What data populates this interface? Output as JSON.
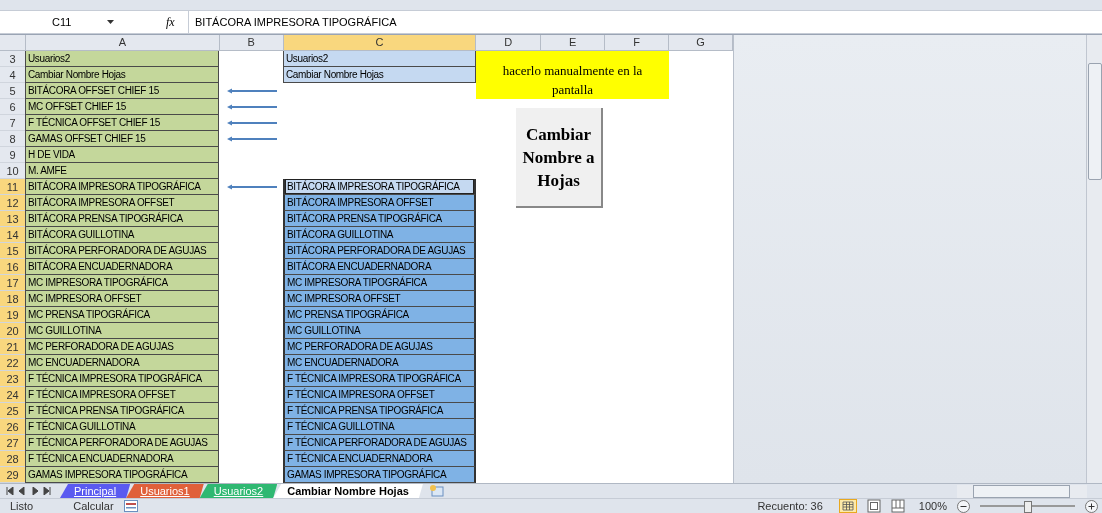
{
  "formula_bar": {
    "name_box": "C11",
    "fx": "fx",
    "formula": "BITÁCORA IMPRESORA TIPOGRÁFICA"
  },
  "columns": [
    {
      "label": "A",
      "selected": false
    },
    {
      "label": "B",
      "selected": false
    },
    {
      "label": "C",
      "selected": true
    },
    {
      "label": "D",
      "selected": false
    },
    {
      "label": "E",
      "selected": false
    },
    {
      "label": "F",
      "selected": false
    },
    {
      "label": "G",
      "selected": false
    }
  ],
  "rows": [
    {
      "num": "3",
      "a": "Usuarios2",
      "arrow": false,
      "c": "Usuarios2",
      "selected": false,
      "active": false
    },
    {
      "num": "4",
      "a": "Cambiar Nombre Hojas",
      "arrow": false,
      "c": "Cambiar Nombre Hojas",
      "selected": false,
      "active": false
    },
    {
      "num": "5",
      "a": "BITÁCORA OFFSET CHIEF 15",
      "arrow": true,
      "selected": false
    },
    {
      "num": "6",
      "a": "MC OFFSET CHIEF 15",
      "arrow": true,
      "selected": false
    },
    {
      "num": "7",
      "a": "F TÉCNICA OFFSET CHIEF 15",
      "arrow": true,
      "selected": false
    },
    {
      "num": "8",
      "a": "GAMAS OFFSET CHIEF 15",
      "arrow": true,
      "selected": false
    },
    {
      "num": "9",
      "a": "H DE VIDA",
      "arrow": false,
      "selected": false
    },
    {
      "num": "10",
      "a": "M. AMFE",
      "arrow": false,
      "selected": false
    },
    {
      "num": "11",
      "a": "BITÁCORA IMPRESORA TIPOGRÁFICA",
      "arrow": true,
      "c": "BITÁCORA IMPRESORA TIPOGRÁFICA",
      "selected": true,
      "active": true
    },
    {
      "num": "12",
      "a": "BITÁCORA IMPRESORA OFFSET",
      "arrow": false,
      "c": "BITÁCORA IMPRESORA OFFSET",
      "selected": true,
      "active": false
    },
    {
      "num": "13",
      "a": "BITÁCORA PRENSA TIPOGRÁFICA",
      "arrow": false,
      "c": "BITÁCORA PRENSA TIPOGRÁFICA",
      "selected": true,
      "active": false
    },
    {
      "num": "14",
      "a": "BITÁCORA GUILLOTINA",
      "arrow": false,
      "c": "BITÁCORA GUILLOTINA",
      "selected": true,
      "active": false
    },
    {
      "num": "15",
      "a": "BITÁCORA PERFORADORA DE AGUJAS",
      "arrow": false,
      "c": "BITÁCORA PERFORADORA DE AGUJAS",
      "selected": true,
      "active": false
    },
    {
      "num": "16",
      "a": "BITÁCORA ENCUADERNADORA",
      "arrow": false,
      "c": "BITÁCORA ENCUADERNADORA",
      "selected": true,
      "active": false
    },
    {
      "num": "17",
      "a": "MC IMPRESORA TIPOGRÁFICA",
      "arrow": false,
      "c": "MC IMPRESORA TIPOGRÁFICA",
      "selected": true,
      "active": false
    },
    {
      "num": "18",
      "a": "MC IMPRESORA OFFSET",
      "arrow": false,
      "c": "MC IMPRESORA OFFSET",
      "selected": true,
      "active": false
    },
    {
      "num": "19",
      "a": "MC PRENSA TIPOGRÁFICA",
      "arrow": false,
      "c": "MC PRENSA TIPOGRÁFICA",
      "selected": true,
      "active": false
    },
    {
      "num": "20",
      "a": "MC GUILLOTINA",
      "arrow": false,
      "c": "MC GUILLOTINA",
      "selected": true,
      "active": false
    },
    {
      "num": "21",
      "a": "MC PERFORADORA DE AGUJAS",
      "arrow": false,
      "c": "MC PERFORADORA DE AGUJAS",
      "selected": true,
      "active": false
    },
    {
      "num": "22",
      "a": "MC ENCUADERNADORA",
      "arrow": false,
      "c": "MC ENCUADERNADORA",
      "selected": true,
      "active": false
    },
    {
      "num": "23",
      "a": "F TÉCNICA IMPRESORA TIPOGRÁFICA",
      "arrow": false,
      "c": "F TÉCNICA IMPRESORA TIPOGRÁFICA",
      "selected": true,
      "active": false
    },
    {
      "num": "24",
      "a": "F TÉCNICA IMPRESORA OFFSET",
      "arrow": false,
      "c": "F TÉCNICA IMPRESORA OFFSET",
      "selected": true,
      "active": false
    },
    {
      "num": "25",
      "a": "F TÉCNICA PRENSA TIPOGRÁFICA",
      "arrow": false,
      "c": "F TÉCNICA PRENSA TIPOGRÁFICA",
      "selected": true,
      "active": false
    },
    {
      "num": "26",
      "a": "F TÉCNICA GUILLOTINA",
      "arrow": false,
      "c": "F TÉCNICA GUILLOTINA",
      "selected": true,
      "active": false
    },
    {
      "num": "27",
      "a": "F TÉCNICA PERFORADORA DE AGUJAS",
      "arrow": false,
      "c": "F TÉCNICA PERFORADORA DE AGUJAS",
      "selected": true,
      "active": false
    },
    {
      "num": "28",
      "a": "F TÉCNICA ENCUADERNADORA",
      "arrow": false,
      "c": "F TÉCNICA ENCUADERNADORA",
      "selected": true,
      "active": false
    },
    {
      "num": "29",
      "a": "GAMAS IMPRESORA TIPOGRÁFICA",
      "arrow": false,
      "c": "GAMAS IMPRESORA TIPOGRÁFICA",
      "selected": true,
      "active": false
    }
  ],
  "note": "hacerlo manualmente en la pantalla",
  "macro_button": "Cambiar Nombre a Hojas",
  "sheet_tabs": [
    {
      "label": "Principal",
      "color": "#5a5af0",
      "selected": false
    },
    {
      "label": "Usuarios1",
      "color": "#e0603a",
      "selected": false
    },
    {
      "label": "Usuarios2",
      "color": "#2fb872",
      "selected": false
    },
    {
      "label": "Cambiar Nombre Hojas",
      "selected": true
    }
  ],
  "status_bar": {
    "ready": "Listo",
    "calculate": "Calcular",
    "count": "Recuento: 36",
    "zoom": "100%",
    "zoom_slider": {
      "level": 0.5
    }
  }
}
